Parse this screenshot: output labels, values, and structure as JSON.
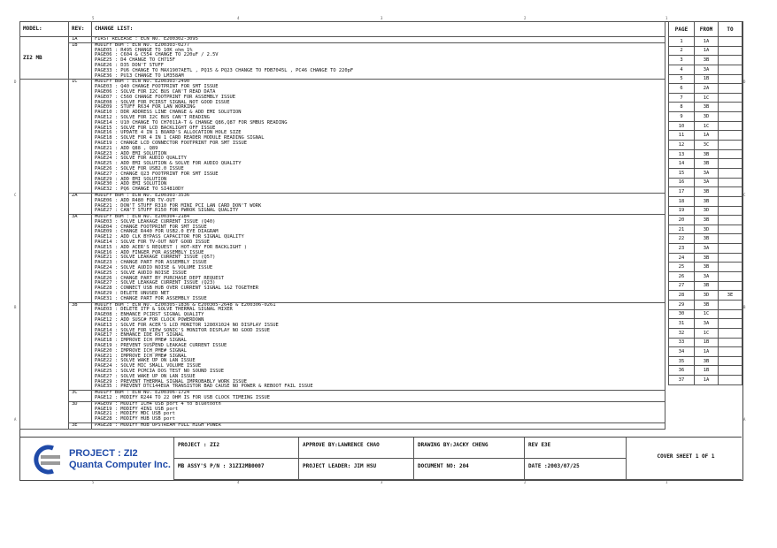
{
  "header": {
    "model": "MODEL:",
    "rev": "REV:",
    "change": "CHANGE LIST:",
    "page": "PAGE",
    "from": "FROM",
    "to": "TO"
  },
  "model_name": "ZI2 MB",
  "revisions": [
    {
      "rev": "1A",
      "lines": [
        "FIRST RELEASE  : ECN NO. E200302-3095"
      ]
    },
    {
      "rev": "1B",
      "lines": [
        "MODIFY BOM : ECN NO. E200303-0277",
        "PAGE05 : R495 CHANGE TO 10K ohm 1%",
        "PAGE06 : C604 & C554 CHANGE TO 220uF / 2.5V",
        "PAGE25 : D4 CHANGE TO CH715F",
        "PAGE26 : D35 DON'T STUFF",
        "PAGE33 : PU6 CHANGE TO MAX1907AETL , PQ15 & PQ23 CHANGE TO FDB7045L , PC46 CHANGE TO 220pF",
        "PAGE36 : PU13 CHANGE TO LM358AM"
      ]
    },
    {
      "rev": "1C",
      "lines": [
        "MODIFY BOM : ECN NO. E200303-2490",
        "PAGE03 : Q40 CHANGE FOOTPRINT FOR SMT ISSUE",
        "PAGE06 : SOLVE FOR I2C BUS CAN'T READ DATA",
        "PAGE07 : C560 CHANGE FOOTPRINT FOR ASSEMBLY ISSUE",
        "PAGE08 : SOLVE FOR PCIRST SIGNAL NOT GOOD ISSUE",
        "PAGE09 : STUFF R634 FOR LAN WORKING",
        "PAGE10 : DDR ADDRESS LINE CHANGE & ADD EMI SOLUTION",
        "PAGE12 : SOLVE FOR I2C BUS CAN'T READING",
        "PAGE14 : U10 CHANGE TO CH7011A-T & CHANGE Q86,Q87 FOR SMBUS READING",
        "PAGE15 : SOLVE FOR LCD BACKLIGHT OFF ISSUE",
        "PAGE16 : UPDATE 4 IN 1 BOARD'S ALLOCATION HOLE SIZE",
        "PAGE18 : SOLVE FOR 4 IN 1 CARD READER MODULE READING SIGNAL",
        "PAGE19 : CHANGE LCD CONNECTOR FOOTPRINT FOR SMT ISSUE",
        "PAGE21 : ADD Q88 , Q89",
        "PAGE23 : ADD EMI SOLUTION",
        "PAGE24 : SOLVE FOR AUDIO QUALITY",
        "PAGE25 : ADD EMI SOLUTION & SOLVE FOR AUDIO QUALITY",
        "PAGE26 : SOLVE FOR USB2.0 ISSUE",
        "PAGE27 : CHANGE Q23 FOOTPRINT FOR SMT ISSUE",
        "PAGE29 : ADD EMI SOLUTION",
        "PAGE30 : ADD EMI SOLUTION",
        "PAGE32 : PQ6 CHANGE TO SI4810DY"
      ]
    },
    {
      "rev": "2A",
      "lines": [
        "MODIFY BOM : ECN NO. E200303-3536",
        "PAGE06 : ADD R480 FOR TV-OUT",
        "PAGE21 : DON'T STUFF R310 FOR MINI PCI LAN CARD DON'T WORK",
        "PAGE27 : CAN'T STUFF R150 FOR PWROK SIGNAL QUALITY"
      ]
    },
    {
      "rev": "3A",
      "lines": [
        "MODIFY BOM : ECN NO. E200304-2184",
        "PAGE03 : SOLVE LEAKAGE CURRENT ISSUE (Q40)",
        "PAGE04 : CHANGE FOOTPRINT FOR SMT ISSUE",
        "PAGE09 : CHANGE R440 FOR USB2.0 EYE DIAGRAM",
        "PAGE12 : ADD CLK BYPASS CAPACITOR FOR SIGNAL QUALITY",
        "PAGE14 : SOLVE FOR TV-OUT NOT GOOD ISSUE",
        "PAGE15 : ADD ACER'S REQUEST ( HOT-KEY FOR BACKLIGHT )",
        "PAGE16 : ADD FINGER FOR ASSEMBLY ISSUE",
        "PAGE21 : SOLVE LEAKAGE CURRENT ISSUE (Q57)",
        "PAGE23 : CHANGE PART FOR ASSEMBLY ISSUE",
        "PAGE24 : SOLVE AUDIO NOISE & VOLUME ISSUE",
        "PAGE25 : SOLVE AUDIO NOISE ISSUE",
        "PAGE26 : CHANGE PART BY PURCHASE DEPT REQUEST",
        "PAGE27 : SOLVE LEAKAGE CURRENT ISSUE (Q23)",
        "PAGE28 : CONNECT USB HUB OVER CURRENT SIGNAL 1&2 TOGETHER",
        "PAGE29 : DELETE UNUSED NET",
        "PAGE31 : CHANGE PART FOR ASSEMBLY ISSUE"
      ]
    },
    {
      "rev": "3B",
      "lines": [
        "MODIFY BOM : ECN NO. E200305-1836 & E200305-2648 & E200306-0261",
        "PAGE03 : DELETE ITP & SOLVE THERMAL SIGNAL MIXER",
        "PAGE08 : ENHANCE PCIRST SIGNAL QUALITY",
        "PAGE12 : ADD SUSC# FOR CLOCK POWERDOWN",
        "PAGE13 : SOLVE FOR ACER'S LCD MONITOR 1280X1024 NO DISPLAY ISSUE",
        "PAGE14 : SOLVE FOR VIEW SONIC'S MONITOR DISPLAY NO GOOD ISSUE",
        "PAGE17 : ENHANCE IDE RST SIGNAL",
        "PAGE18 : IMPROVE ICH_PME# SIGNAL",
        "PAGE19 : PREVENT SUSPEND LEAKAGE CURRENT ISSUE",
        "PAGE20 : IMPROVE ICH_PME# SIGNAL",
        "PAGE21 : IMPROVE ICH_PME# SIGNAL",
        "PAGE22 : SOLVE WAKE UP ON LAN ISSUE",
        "PAGE24 : SOLVE MIC SMALL VOLUME ISSUE",
        "PAGE25 : SOLVE PCMCIA DOS TEST NO SOUND ISSUE",
        "PAGE27 : SOLVE WAKE UP ON LAN ISSUE",
        "PAGE29 : PREVENT THERMAL SIGNAL IMPROBABLY WORK ISSUE",
        "PAGE35 : PREVENT DTC144EUA TRANSISTOR BAD CAUSE NO POWER & REBOOT FAIL ISSUE"
      ]
    },
    {
      "rev": "3C",
      "lines": [
        "MODIFY BOM : ECN NO. E200306-1724",
        "PAGE12 : MODIFY R244 TO 22 OHM IS FOR USB CLOCK TIMEING ISSUE"
      ]
    },
    {
      "rev": "3D",
      "lines": [
        "PAGE09 : MODIFY ICH4 USB port 4 to Bluetooth",
        "PAGE19 : MODIFY 4IN1 USB port",
        "PAGE21 : MODIFY MDC USB port",
        "PAGE28 : MODIFY HUB USB port"
      ]
    },
    {
      "rev": "3E",
      "lines": [
        "PAGE28 : MODIFY HUB UPSTREAM FULL HIGH POWER"
      ]
    }
  ],
  "page_table": [
    [
      "1",
      "1A",
      ""
    ],
    [
      "2",
      "1A",
      ""
    ],
    [
      "3",
      "3B",
      ""
    ],
    [
      "4",
      "3A",
      ""
    ],
    [
      "5",
      "1B",
      ""
    ],
    [
      "6",
      "2A",
      ""
    ],
    [
      "7",
      "1C",
      ""
    ],
    [
      "8",
      "3B",
      ""
    ],
    [
      "9",
      "3D",
      ""
    ],
    [
      "10",
      "1C",
      ""
    ],
    [
      "11",
      "1A",
      ""
    ],
    [
      "12",
      "3C",
      ""
    ],
    [
      "13",
      "3B",
      ""
    ],
    [
      "14",
      "3B",
      ""
    ],
    [
      "15",
      "3A",
      ""
    ],
    [
      "16",
      "3A",
      ""
    ],
    [
      "17",
      "3B",
      ""
    ],
    [
      "18",
      "3B",
      ""
    ],
    [
      "19",
      "3D",
      ""
    ],
    [
      "20",
      "3B",
      ""
    ],
    [
      "21",
      "3D",
      ""
    ],
    [
      "22",
      "3B",
      ""
    ],
    [
      "23",
      "3A",
      ""
    ],
    [
      "24",
      "3B",
      ""
    ],
    [
      "25",
      "3B",
      ""
    ],
    [
      "26",
      "3A",
      ""
    ],
    [
      "27",
      "3B",
      ""
    ],
    [
      "28",
      "3D",
      "3E"
    ],
    [
      "29",
      "3B",
      ""
    ],
    [
      "30",
      "1C",
      ""
    ],
    [
      "31",
      "3A",
      ""
    ],
    [
      "32",
      "1C",
      ""
    ],
    [
      "33",
      "1B",
      ""
    ],
    [
      "34",
      "1A",
      ""
    ],
    [
      "35",
      "3B",
      ""
    ],
    [
      "36",
      "1B",
      ""
    ],
    [
      "37",
      "1A",
      ""
    ]
  ],
  "title_block": {
    "project_name": "PROJECT : ZI2",
    "company": "Quanta Computer Inc.",
    "project": "PROJECT : ZI2",
    "approve": "APPROVE BY:LAWRENCE CHAO",
    "drawing": "DRAWING BY:JACKY CHENG",
    "rev": "REV E3E",
    "assy": "MB ASSY'S P/N : 31ZI2MB0007",
    "leader": "PROJECT LEADER: JIM HSU",
    "document": "DOCUMENT NO: 204",
    "date": "DATE :2003/07/25",
    "cover": "COVER SHEET 1 OF 1"
  },
  "ruler_top": [
    "5",
    "4",
    "3",
    "2",
    "1"
  ],
  "ruler_side": [
    "D",
    "C",
    "B",
    "A"
  ],
  "colors": {
    "logo_blue": "#1f4aa8",
    "logo_gray": "#9a9a9a"
  }
}
